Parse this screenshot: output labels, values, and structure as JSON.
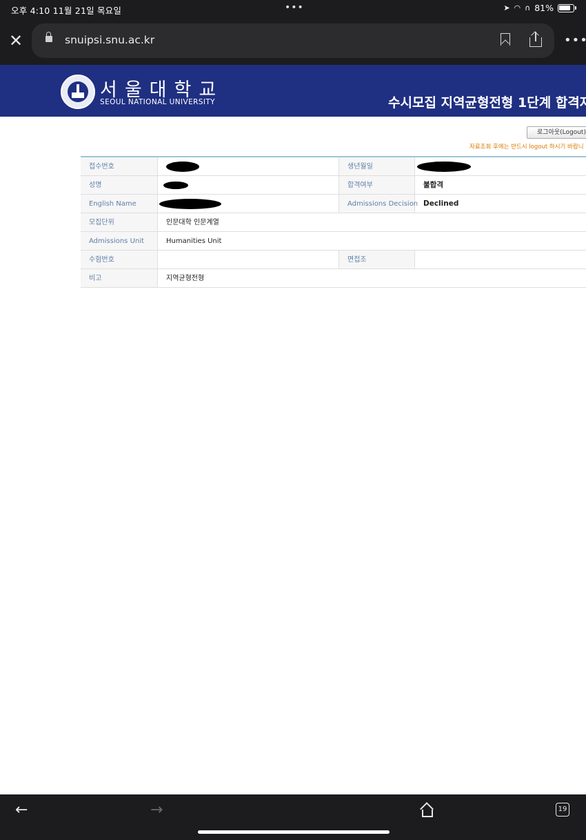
{
  "status_bar": {
    "time_date": "오후 4:10   11월 21일 목요일",
    "dots": "•••",
    "battery": "81%"
  },
  "browser": {
    "url": "snuipsi.snu.ac.kr",
    "close_icon": "close-icon",
    "bookmark_icon": "bookmark-icon",
    "share_icon": "share-icon",
    "more_icon": "more-icon",
    "tab_count": "19"
  },
  "header": {
    "university_kr": "서울대학교",
    "university_en": "SEOUL NATIONAL UNIVERSITY",
    "page_title": "수시모집 지역균형전형 1단계 합격자",
    "bg_color": "#1f2f82"
  },
  "logout": {
    "label": "로그아웃(Logout)",
    "notice": "자료조회 후에는 반드시 logout 하시기 바랍니"
  },
  "info": {
    "application_no_label": "접수번호",
    "birthdate_label": "생년월일",
    "name_label": "성명",
    "result_label": "합격여부",
    "result_value": "불합격",
    "english_name_label": "English Name",
    "admissions_decision_label": "Admissions Decision",
    "admissions_decision_value": "Declined",
    "unit_label": "모집단위",
    "unit_value": "인문대학 인문계열",
    "admissions_unit_label": "Admissions Unit",
    "admissions_unit_value": "Humanities Unit",
    "exam_no_label": "수험번호",
    "exam_no_value": "",
    "interview_group_label": "면접조",
    "interview_group_value": "",
    "remarks_label": "비고",
    "remarks_value": "지역균형전형"
  }
}
